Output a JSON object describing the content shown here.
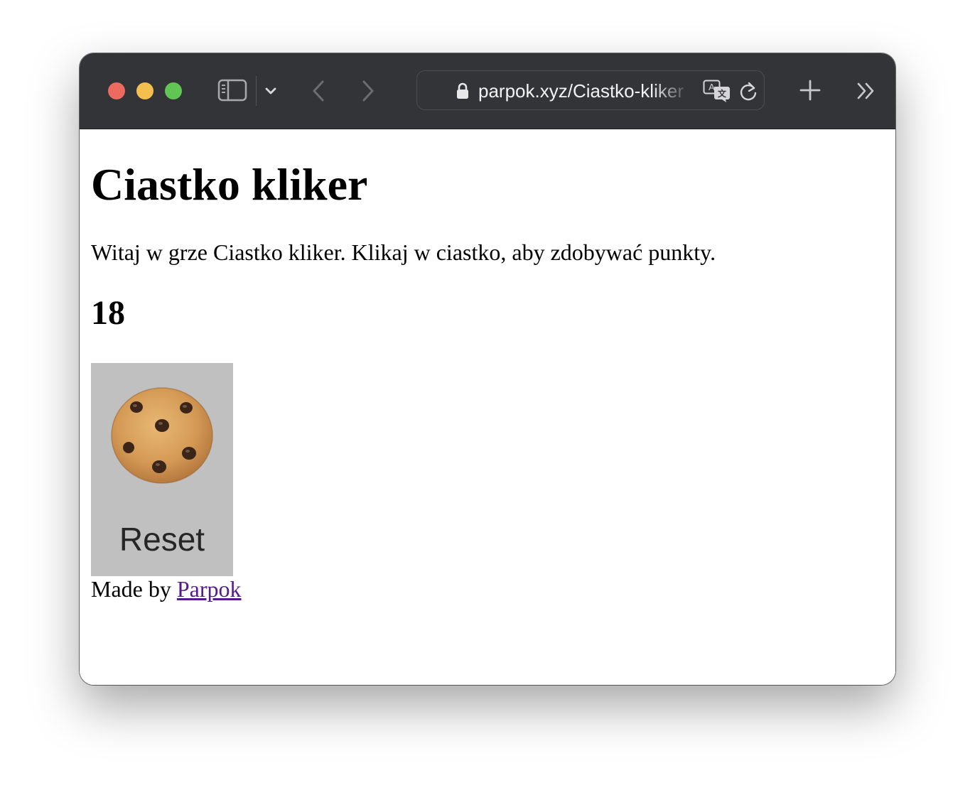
{
  "browser": {
    "url_display": "parpok.xyz/Ciastko-kliker",
    "icons": {
      "sidebar": "sidebar-icon",
      "dropdown": "chevron-down-icon",
      "back": "chevron-left-icon",
      "forward": "chevron-right-icon",
      "lock": "lock-icon",
      "translate": "translate-icon",
      "reload": "reload-icon",
      "new_tab": "plus-icon",
      "more": "double-chevron-right-icon"
    }
  },
  "page": {
    "title": "Ciastko kliker",
    "intro": "Witaj w grze Ciastko kliker. Klikaj w ciastko, aby zdobywać punkty.",
    "score": "18",
    "reset_label": "Reset",
    "footer_prefix": "Made by ",
    "footer_link": "Parpok"
  },
  "colors": {
    "toolbar_bg": "#333437",
    "button_bg": "#c0c0c0",
    "link_visited": "#551a8b",
    "traffic_close": "#ed6a5e",
    "traffic_min": "#f5bf4f",
    "traffic_max": "#61c554"
  }
}
